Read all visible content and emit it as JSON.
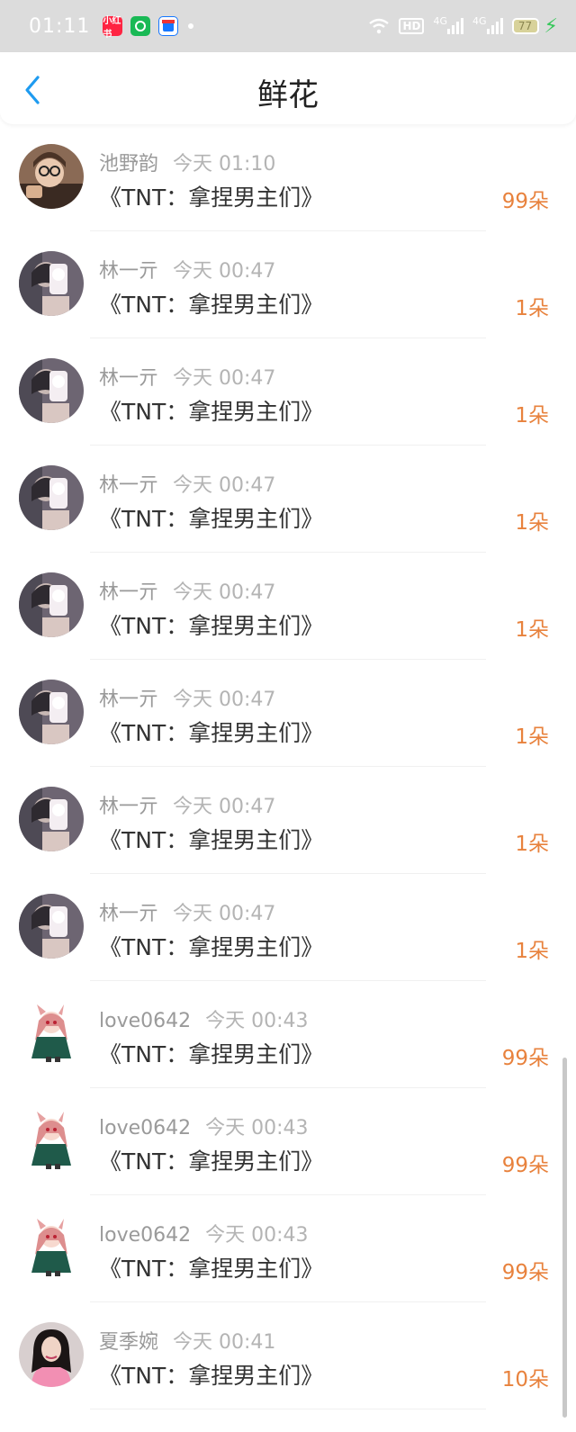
{
  "status_bar": {
    "time": "01:11",
    "apps": [
      {
        "icon": "xiaohongshu-app-icon",
        "text": "小红书",
        "color": "#ff2442"
      },
      {
        "icon": "green-app-icon",
        "text": "",
        "color": "#19b955"
      },
      {
        "icon": "alipay-app-icon",
        "text": "",
        "color": "#1677ff"
      }
    ],
    "hd": "HD",
    "network_1": "4G",
    "network_2": "4G",
    "battery": "77"
  },
  "header": {
    "title": "鲜花"
  },
  "flowers": [
    {
      "user": "池野韵",
      "time": "今天 01:10",
      "book": "《TNT：拿捏男主们》",
      "count": "99朵",
      "avatar": "photo-girl-glasses"
    },
    {
      "user": "林一亓",
      "time": "今天 00:47",
      "book": "《TNT：拿捏男主们》",
      "count": "1朵",
      "avatar": "photo-mirror-selfie"
    },
    {
      "user": "林一亓",
      "time": "今天 00:47",
      "book": "《TNT：拿捏男主们》",
      "count": "1朵",
      "avatar": "photo-mirror-selfie"
    },
    {
      "user": "林一亓",
      "time": "今天 00:47",
      "book": "《TNT：拿捏男主们》",
      "count": "1朵",
      "avatar": "photo-mirror-selfie"
    },
    {
      "user": "林一亓",
      "time": "今天 00:47",
      "book": "《TNT：拿捏男主们》",
      "count": "1朵",
      "avatar": "photo-mirror-selfie"
    },
    {
      "user": "林一亓",
      "time": "今天 00:47",
      "book": "《TNT：拿捏男主们》",
      "count": "1朵",
      "avatar": "photo-mirror-selfie"
    },
    {
      "user": "林一亓",
      "time": "今天 00:47",
      "book": "《TNT：拿捏男主们》",
      "count": "1朵",
      "avatar": "photo-mirror-selfie"
    },
    {
      "user": "林一亓",
      "time": "今天 00:47",
      "book": "《TNT：拿捏男主们》",
      "count": "1朵",
      "avatar": "photo-mirror-selfie"
    },
    {
      "user": "love0642",
      "time": "今天 00:43",
      "book": "《TNT：拿捏男主们》",
      "count": "99朵",
      "avatar": "anime-girl"
    },
    {
      "user": "love0642",
      "time": "今天 00:43",
      "book": "《TNT：拿捏男主们》",
      "count": "99朵",
      "avatar": "anime-girl"
    },
    {
      "user": "love0642",
      "time": "今天 00:43",
      "book": "《TNT：拿捏男主们》",
      "count": "99朵",
      "avatar": "anime-girl"
    },
    {
      "user": "夏季婉",
      "time": "今天 00:41",
      "book": "《TNT：拿捏男主们》",
      "count": "10朵",
      "avatar": "photo-girl-pink"
    }
  ],
  "colors": {
    "accent_blue": "#1e9bf0",
    "count_orange": "#e8823d"
  }
}
